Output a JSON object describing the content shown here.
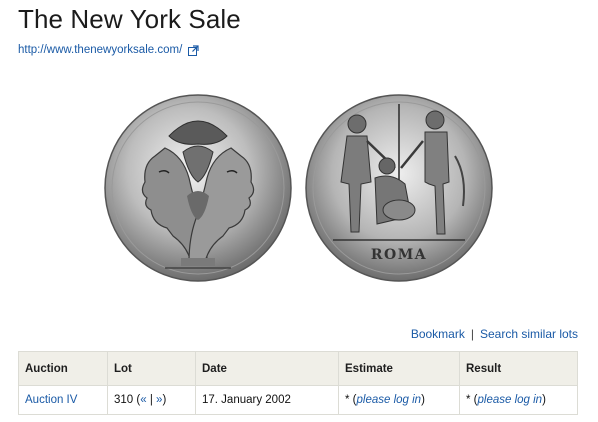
{
  "page": {
    "title": "The New York Sale",
    "site_url_text": "http://www.thenewyorksale.com/"
  },
  "coin": {
    "obverse_icon": "janus-head-coin",
    "reverse_icon": "oath-scene-coin",
    "legend": "ROMA"
  },
  "actions": {
    "bookmark": "Bookmark",
    "separator": "|",
    "search_similar": "Search similar lots"
  },
  "table": {
    "headers": [
      "Auction",
      "Lot",
      "Date",
      "Estimate",
      "Result"
    ],
    "row": {
      "auction": "Auction IV",
      "lot_number": "310",
      "lot_open": "(",
      "lot_prev": "«",
      "lot_sep": "|",
      "lot_next": "»",
      "lot_close": ")",
      "date": "17. January 2002",
      "estimate_prefix": "* (",
      "estimate_link": "please log in",
      "estimate_suffix": ")",
      "result_prefix": "* (",
      "result_link": "please log in",
      "result_suffix": ")"
    }
  },
  "colors": {
    "link": "#1a5aa6",
    "table_header_bg": "#f0efe8"
  }
}
